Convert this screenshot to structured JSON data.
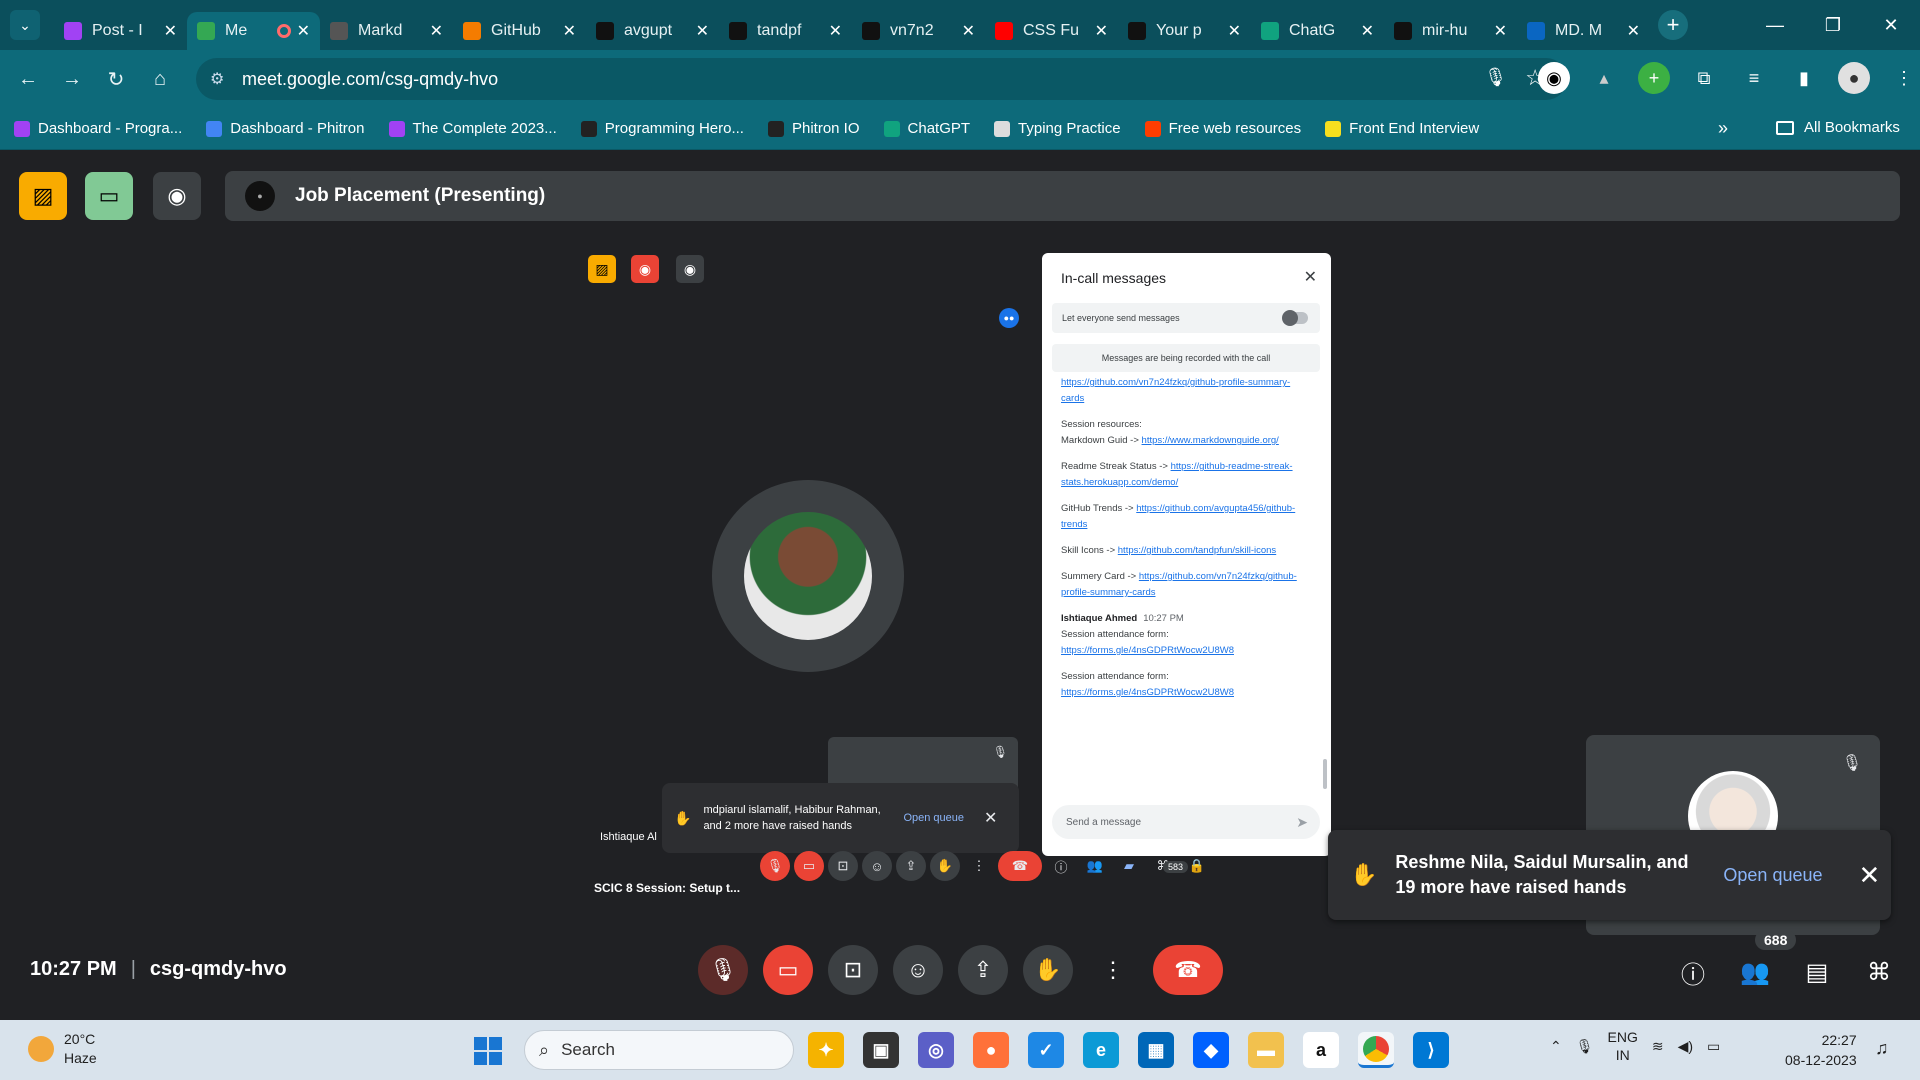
{
  "browser": {
    "tabs": [
      {
        "title": "Post - I",
        "color": "#a142f4"
      },
      {
        "title": "Me",
        "color": "#34a853",
        "active": true,
        "recording": true
      },
      {
        "title": "Markd",
        "color": "#555555"
      },
      {
        "title": "GitHub",
        "color": "#f57c00"
      },
      {
        "title": "avgupt",
        "color": "#111111"
      },
      {
        "title": "tandpf",
        "color": "#111111"
      },
      {
        "title": "vn7n2",
        "color": "#111111"
      },
      {
        "title": "CSS Fu",
        "color": "#ff0000"
      },
      {
        "title": "Your p",
        "color": "#111111"
      },
      {
        "title": "ChatG",
        "color": "#10a37f"
      },
      {
        "title": "mir-hu",
        "color": "#111111"
      },
      {
        "title": "MD. M",
        "color": "#0a66c2"
      }
    ],
    "url": "meet.google.com/csg-qmdy-hvo",
    "bookmarks": [
      {
        "label": "Dashboard - Progra...",
        "color": "#a142f4"
      },
      {
        "label": "Dashboard - Phitron",
        "color": "#4285f4"
      },
      {
        "label": "The Complete 2023...",
        "color": "#a142f4"
      },
      {
        "label": "Programming Hero...",
        "color": "#222222"
      },
      {
        "label": "Phitron IO",
        "color": "#222222"
      },
      {
        "label": "ChatGPT",
        "color": "#10a37f"
      },
      {
        "label": "Typing Practice",
        "color": "#dddddd"
      },
      {
        "label": "Free web resources",
        "color": "#ff3d00"
      },
      {
        "label": "Front End Interview",
        "color": "#f7df1e"
      }
    ],
    "all_bookmarks": "All Bookmarks"
  },
  "meet": {
    "presenting_title": "Job Placement (Presenting)",
    "time": "10:27 PM",
    "meeting_code": "csg-qmdy-hvo",
    "participants_count": "688",
    "raise_toast": {
      "text": "Reshme Nila, Saidul Mursalin, and 19 more have raised hands",
      "action": "Open queue"
    }
  },
  "shared_screen": {
    "chat": {
      "title": "In-call messages",
      "toggle_label": "Let everyone send messages",
      "recording_note": "Messages are being recorded with the call",
      "input_placeholder": "Send a message",
      "messages": [
        {
          "link": "https://github.com/vn7n24fzkq/github-profile-summary-cards"
        },
        {
          "text": "Session resources:\nMarkdown Guid -> ",
          "link": "https://www.markdownguide.org/"
        },
        {
          "text": "Readme Streak Status -> ",
          "link": "https://github-readme-streak-stats.herokuapp.com/demo/"
        },
        {
          "text": "GitHub Trends -> ",
          "link": "https://github.com/avgupta456/github-trends"
        },
        {
          "text": "Skill Icons -> ",
          "link": "https://github.com/tandpfun/skill-icons"
        },
        {
          "text": "Summery Card -> ",
          "link": "https://github.com/vn7n24fzkq/github-profile-summary-cards"
        }
      ],
      "sender": {
        "name": "Ishtiaque Ahmed",
        "time": "10:27 PM"
      },
      "form_label": "Session attendance form:",
      "form_link": "https://forms.gle/4nsGDPRtWocw2U8W8"
    },
    "raise_toast": {
      "text": "mdpiarul islamalif, Habibur Rahman, and 2 more have raised hands",
      "action": "Open queue"
    },
    "participant_name": "Ishtiaque Al",
    "inner_title": "SCIC 8 Session: Setup t...",
    "inner_count": "583"
  },
  "taskbar": {
    "weather_temp": "20°C",
    "weather_desc": "Haze",
    "search_label": "Search",
    "lang": "ENG",
    "region": "IN",
    "time": "22:27",
    "date": "08-12-2023"
  }
}
